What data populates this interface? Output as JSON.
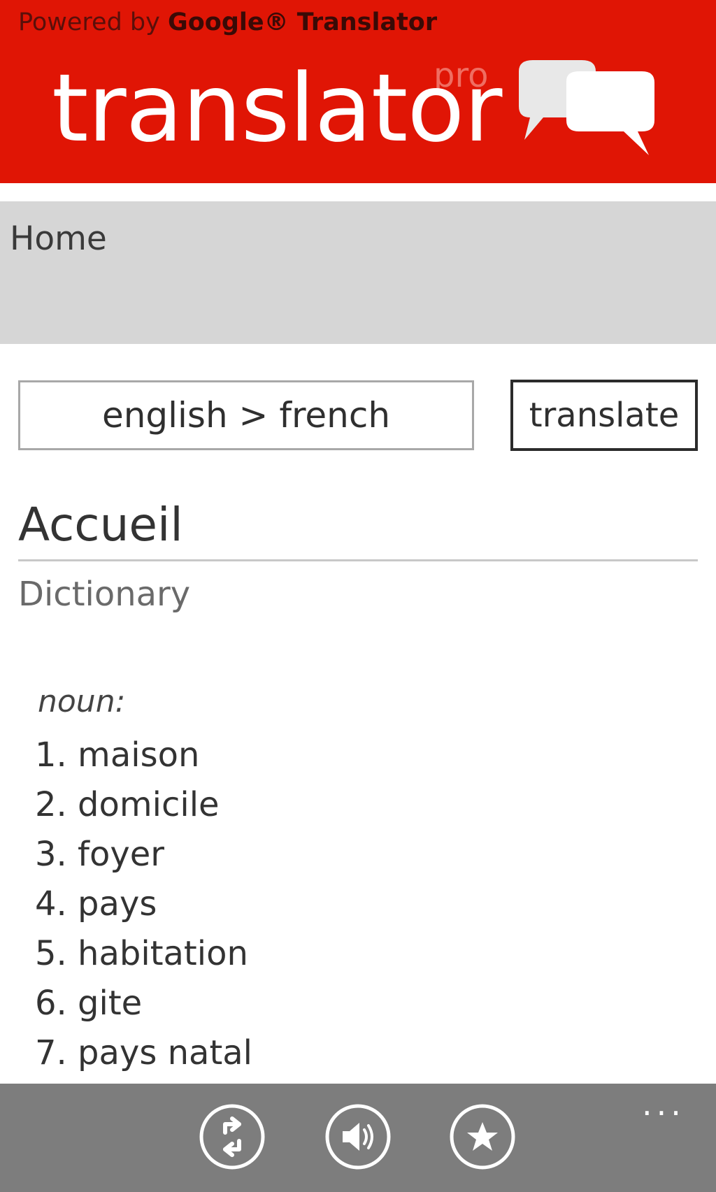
{
  "header": {
    "powered_prefix": "Powered by",
    "powered_brand": "Google® Translator",
    "app_title": "translator",
    "app_title_suffix": "pro",
    "logo_icon": "chat-bubbles-icon",
    "background_color": "#e01505"
  },
  "nav": {
    "current_page": "Home"
  },
  "controls": {
    "language_pair": "english > french",
    "translate_label": "translate"
  },
  "result": {
    "translation": "Accueil",
    "section_label": "Dictionary",
    "part_of_speech": "noun:",
    "definitions": [
      "1. maison",
      "2. domicile",
      "3. foyer",
      "4. pays",
      "5. habitation",
      "6. gite",
      "7. pays natal"
    ]
  },
  "appbar": {
    "more_label": "...",
    "buttons": [
      {
        "icon": "swap-icon"
      },
      {
        "icon": "speaker-icon"
      },
      {
        "icon": "star-icon"
      }
    ],
    "background_color": "#7d7d7d"
  }
}
